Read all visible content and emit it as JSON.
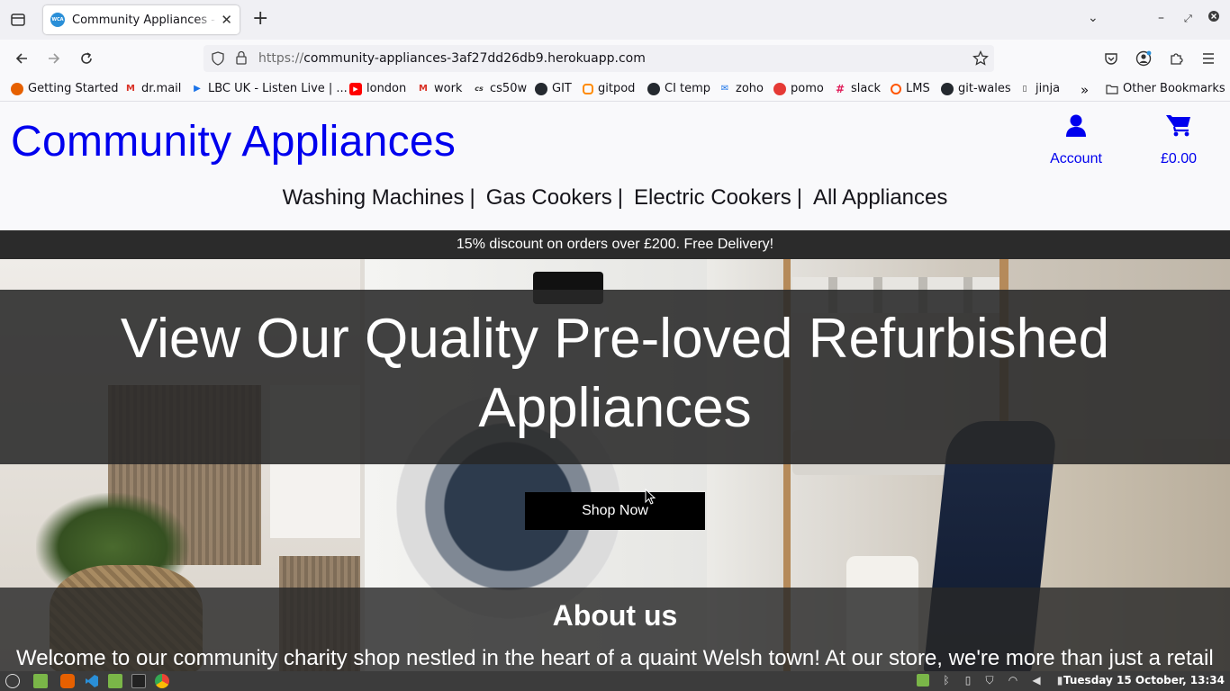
{
  "browser": {
    "tab": {
      "title": "Community Appliances - home",
      "favicon_text": "WCA"
    },
    "url": {
      "prefix": "https://",
      "host": "community-appliances-3af27dd26db9.herokuapp.com"
    },
    "bookmarks": [
      {
        "label": "Getting Started",
        "icon": "firefox-icon",
        "color": "#e66000"
      },
      {
        "label": "dr.mail",
        "icon": "gmail-icon",
        "color": "#d93025"
      },
      {
        "label": "LBC UK - Listen Live | ...",
        "icon": "lbc-icon",
        "color": "#1a73e8"
      },
      {
        "label": "london",
        "icon": "youtube-icon",
        "color": "#ff0000"
      },
      {
        "label": "work",
        "icon": "gmail-icon",
        "color": "#d93025"
      },
      {
        "label": "cs50w",
        "icon": "cs50-icon",
        "color": "#333333"
      },
      {
        "label": "GIT",
        "icon": "github-icon",
        "color": "#24292f"
      },
      {
        "label": "gitpod",
        "icon": "gitpod-icon",
        "color": "#ff8a00"
      },
      {
        "label": "CI temp",
        "icon": "github-icon",
        "color": "#24292f"
      },
      {
        "label": "zoho",
        "icon": "zoho-icon",
        "color": "#1a73e8"
      },
      {
        "label": "pomo",
        "icon": "tomato-icon",
        "color": "#e53935"
      },
      {
        "label": "slack",
        "icon": "slack-icon",
        "color": "#4a154b"
      },
      {
        "label": "LMS",
        "icon": "lms-icon",
        "color": "#ff5500"
      },
      {
        "label": "git-wales",
        "icon": "github-icon",
        "color": "#24292f"
      },
      {
        "label": "jinja",
        "icon": "jinja-icon",
        "color": "#333333"
      }
    ],
    "other_bookmarks": "Other Bookmarks"
  },
  "site": {
    "logo": "Community Appliances",
    "account_label": "Account",
    "cart_total": "£0.00",
    "accent_color": "#0000ee",
    "nav": [
      {
        "label": "Washing Machines",
        "sep": "|"
      },
      {
        "label": "Gas Cookers",
        "sep": "|"
      },
      {
        "label": "Electric Cookers",
        "sep": "|"
      },
      {
        "label": "All Appliances",
        "sep": ""
      }
    ],
    "promo": "15% discount on orders over £200. Free Delivery!",
    "hero": {
      "title_line1": "View Our Quality Pre-loved Refurbished",
      "title_line2": "Appliances",
      "button": "Shop Now"
    },
    "about": {
      "title": "About us",
      "text": "Welcome to our community charity shop nestled in the heart of a quaint Welsh town! At our store, we're more than just a retail"
    }
  },
  "taskbar": {
    "clock": "Tuesday 15 October, 13:34"
  }
}
